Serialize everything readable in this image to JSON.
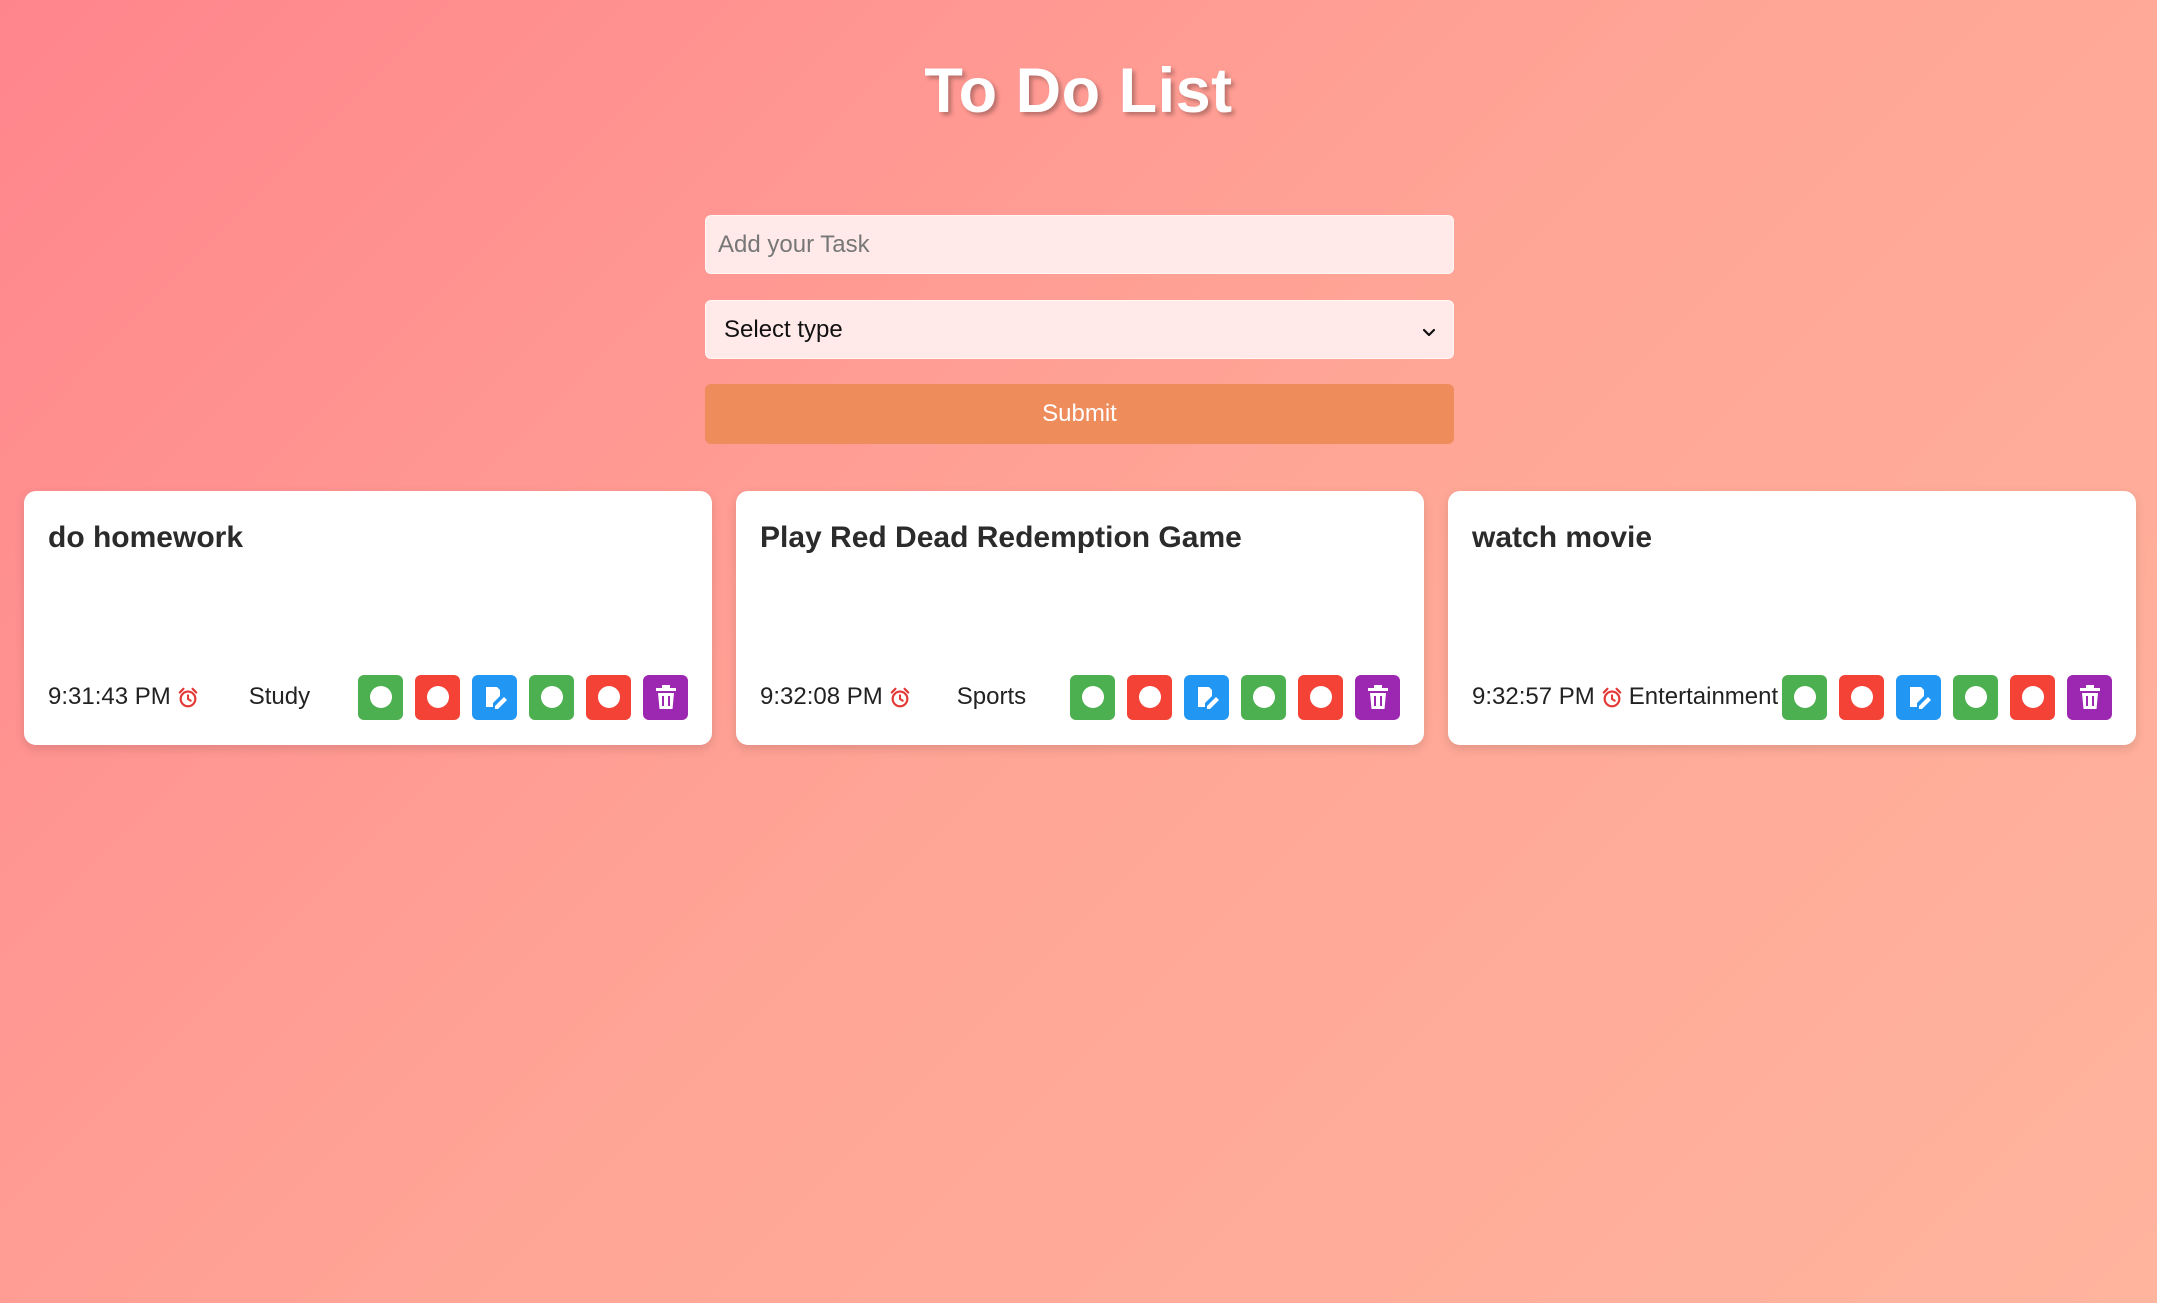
{
  "header": {
    "title": "To Do List"
  },
  "form": {
    "task_placeholder": "Add your Task",
    "type_selected": "Select type",
    "submit_label": "Submit"
  },
  "colors": {
    "accent_submit": "#ee8c5b",
    "complete_green": "#4caf50",
    "red": "#f44336",
    "edit_blue": "#2196f3",
    "delete_purple": "#9c27b0"
  },
  "tasks": [
    {
      "title": "do homework",
      "time": "9:31:43 PM",
      "type": "Study"
    },
    {
      "title": "Play Red Dead Redemption Game",
      "time": "9:32:08 PM",
      "type": "Sports"
    },
    {
      "title": "watch movie",
      "time": "9:32:57 PM",
      "type": "Entertainment"
    }
  ],
  "icons": {
    "alarm": "alarm-clock-icon",
    "check": "circle-icon",
    "edit": "edit-icon",
    "delete": "trash-icon",
    "dropdown": "chevron-down-icon"
  }
}
